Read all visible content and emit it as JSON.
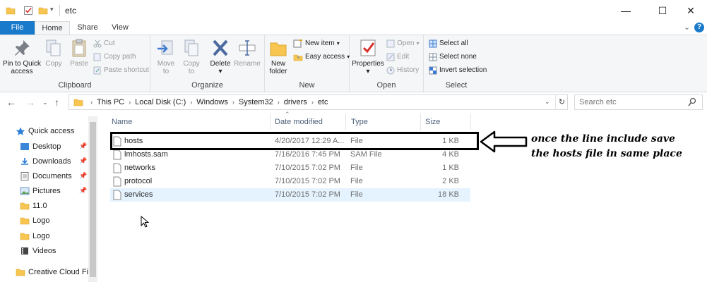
{
  "window": {
    "title": "etc",
    "minimize_glyph": "—",
    "maximize_glyph": "☐",
    "close_glyph": "✕"
  },
  "ribbon_tabs": {
    "file": "File",
    "home": "Home",
    "share": "Share",
    "view": "View"
  },
  "ribbon": {
    "clipboard": {
      "label": "Clipboard",
      "pin_line1": "Pin to Quick",
      "pin_line2": "access",
      "copy": "Copy",
      "paste": "Paste",
      "cut": "Cut",
      "copy_path": "Copy path",
      "paste_shortcut": "Paste shortcut"
    },
    "organize": {
      "label": "Organize",
      "move_line1": "Move",
      "move_line2": "to",
      "copy_line1": "Copy",
      "copy_line2": "to",
      "delete_line1": "Delete",
      "delete_line2": "▾",
      "rename": "Rename"
    },
    "new": {
      "label": "New",
      "new_folder_line1": "New",
      "new_folder_line2": "folder",
      "new_item": "New item",
      "easy_access": "Easy access"
    },
    "open": {
      "label": "Open",
      "properties_line1": "Properties",
      "properties_line2": "▾",
      "open": "Open",
      "edit": "Edit",
      "history": "History"
    },
    "select": {
      "label": "Select",
      "select_all": "Select all",
      "select_none": "Select none",
      "invert": "Invert selection"
    }
  },
  "address": {
    "breadcrumbs": [
      "This PC",
      "Local Disk (C:)",
      "Windows",
      "System32",
      "drivers",
      "etc"
    ],
    "search_placeholder": "Search etc"
  },
  "nav": {
    "quick_access": "Quick access",
    "items": [
      "Desktop",
      "Downloads",
      "Documents",
      "Pictures",
      "11.0",
      "Logo",
      "Logo",
      "Videos"
    ],
    "creative_cloud": "Creative Cloud File"
  },
  "columns": {
    "name": "Name",
    "date": "Date modified",
    "type": "Type",
    "size": "Size"
  },
  "files": [
    {
      "name": "hosts",
      "date": "4/20/2017 12:29 A...",
      "type": "File",
      "size": "1 KB"
    },
    {
      "name": "lmhosts.sam",
      "date": "7/16/2016 7:45 PM",
      "type": "SAM File",
      "size": "4 KB"
    },
    {
      "name": "networks",
      "date": "7/10/2015 7:02 PM",
      "type": "File",
      "size": "1 KB"
    },
    {
      "name": "protocol",
      "date": "7/10/2015 7:02 PM",
      "type": "File",
      "size": "2 KB"
    },
    {
      "name": "services",
      "date": "7/10/2015 7:02 PM",
      "type": "File",
      "size": "18 KB"
    }
  ],
  "annotation": {
    "line1": "once the line include save",
    "line2": "the hosts file in same place"
  },
  "colors": {
    "accent": "#1979ca",
    "selected_row": "#cce8ff",
    "hover_row": "#e5f3ff",
    "folder": "#f8c550"
  }
}
